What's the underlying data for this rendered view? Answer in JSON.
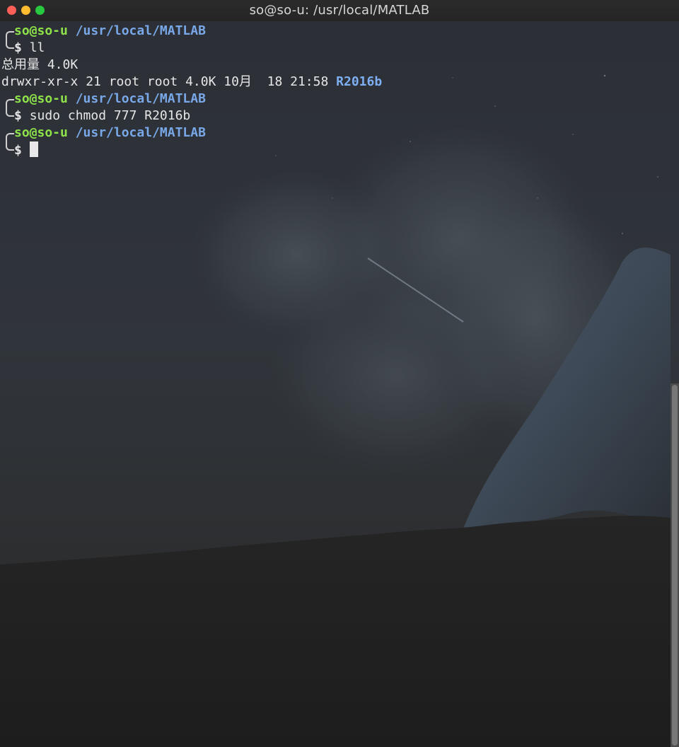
{
  "window": {
    "title": "so@so-u: /usr/local/MATLAB"
  },
  "terminal": {
    "prompts": [
      {
        "user": "so@so-u",
        "path": "/usr/local/MATLAB",
        "symbol": "$",
        "command": "ll"
      },
      {
        "user": "so@so-u",
        "path": "/usr/local/MATLAB",
        "symbol": "$",
        "command": "sudo chmod 777 R2016b"
      },
      {
        "user": "so@so-u",
        "path": "/usr/local/MATLAB",
        "symbol": "$",
        "command": ""
      }
    ],
    "output": {
      "total": "总用量 4.0K",
      "listing_prefix": "drwxr-xr-x 21 root root 4.0K 10月  18 21:58 ",
      "listing_name": "R2016b"
    }
  },
  "colors": {
    "user": "#8ee34a",
    "path": "#79a8e8",
    "text": "#e6e6e6",
    "background": "#1f1f1f"
  },
  "icons": [
    "close-button",
    "minimize-button",
    "maximize-button",
    "terminal-cursor"
  ]
}
